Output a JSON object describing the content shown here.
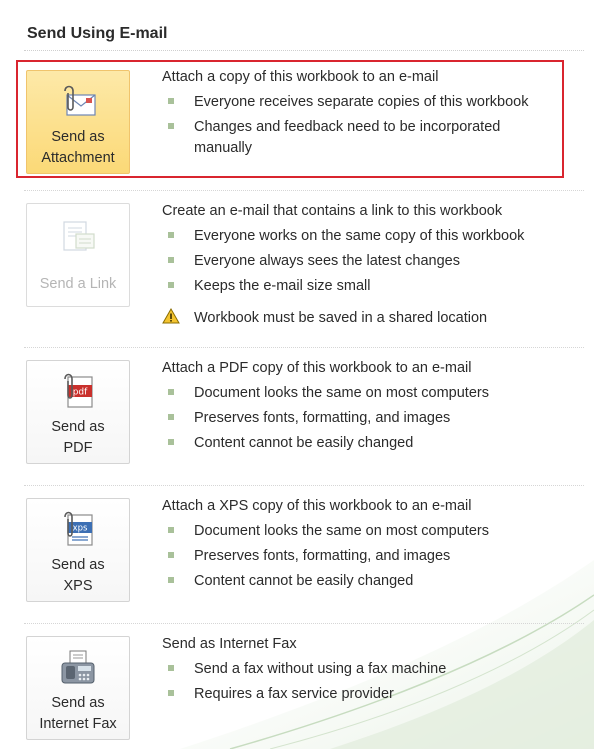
{
  "panel": {
    "title": "Send Using E-mail",
    "accent_color": "#a9c19a",
    "highlight_color": "#d9252f"
  },
  "sections": [
    {
      "button_label": "Send as Attachment",
      "button_label_lines": [
        "Send as",
        "Attachment"
      ],
      "state": "selected",
      "icon": "attachment-icon",
      "heading": "Attach a copy of this workbook to an e-mail",
      "bullets": [
        "Everyone receives separate copies of this workbook",
        "Changes and feedback need to be incorporated manually"
      ]
    },
    {
      "button_label": "Send a Link",
      "button_label_lines": [
        "Send a Link"
      ],
      "state": "disabled",
      "icon": "link-icon",
      "heading": "Create an e-mail that contains a link to this workbook",
      "bullets": [
        "Everyone works on the same copy of this workbook",
        "Everyone always sees the latest changes",
        "Keeps the e-mail size small"
      ],
      "warning": "Workbook must be saved in a shared location"
    },
    {
      "button_label": "Send as PDF",
      "button_label_lines": [
        "Send as",
        "PDF"
      ],
      "state": "normal",
      "icon": "pdf-icon",
      "icon_text": "pdf",
      "heading": "Attach a PDF copy of this workbook to an e-mail",
      "bullets": [
        "Document looks the same on most computers",
        "Preserves fonts, formatting, and images",
        "Content cannot be easily changed"
      ]
    },
    {
      "button_label": "Send as XPS",
      "button_label_lines": [
        "Send as",
        "XPS"
      ],
      "state": "normal",
      "icon": "xps-icon",
      "icon_text": "xps",
      "heading": "Attach a XPS copy of this workbook to an e-mail",
      "bullets": [
        "Document looks the same on most computers",
        "Preserves fonts, formatting, and images",
        "Content cannot be easily changed"
      ]
    },
    {
      "button_label": "Send as Internet Fax",
      "button_label_lines": [
        "Send as",
        "Internet Fax"
      ],
      "state": "normal",
      "icon": "fax-icon",
      "heading": "Send as Internet Fax",
      "bullets": [
        "Send a fax without using a fax machine",
        "Requires a fax service provider"
      ]
    }
  ]
}
